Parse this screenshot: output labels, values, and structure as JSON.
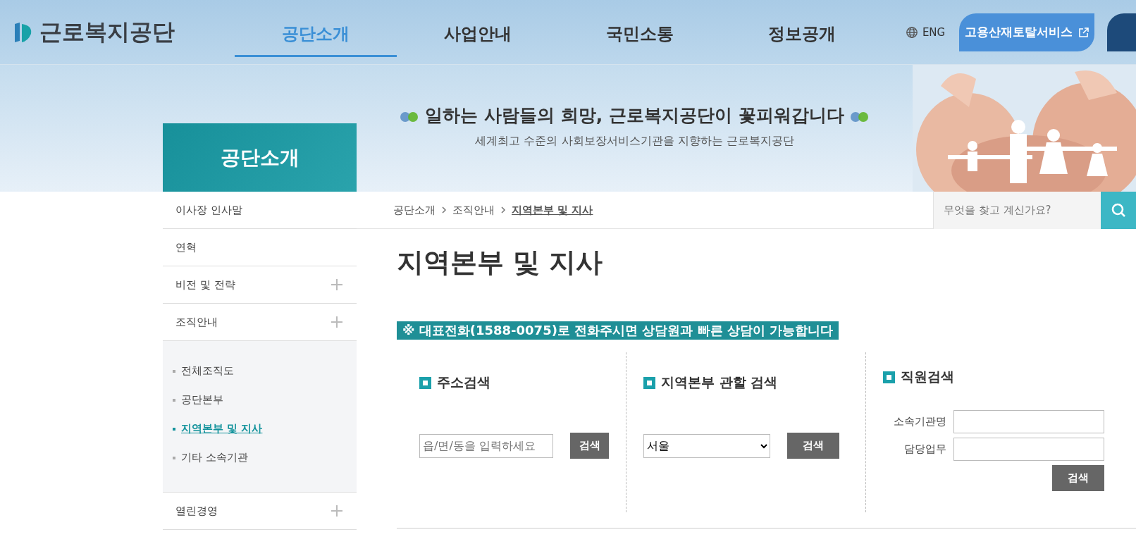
{
  "header": {
    "logo": "근로복지공단",
    "nav": [
      {
        "label": "공단소개",
        "selected": true
      },
      {
        "label": "사업안내",
        "selected": false
      },
      {
        "label": "국민소통",
        "selected": false
      },
      {
        "label": "정보공개",
        "selected": false
      }
    ],
    "language": "ENG",
    "portal_button": "고용산재토탈서비스"
  },
  "banner": {
    "slogan": "일하는 사람들의 희망, 근로복지공단이 꽃피워갑니다",
    "subtitle": "세계최고 수준의 사회보장서비스기관을 지향하는 근로복지공단"
  },
  "sidebar": {
    "title": "공단소개",
    "items": [
      {
        "label": "이사장 인사말",
        "expandable": false
      },
      {
        "label": "연혁",
        "expandable": false
      },
      {
        "label": "비전 및 전략",
        "expandable": true
      },
      {
        "label": "조직안내",
        "expandable": true,
        "children": [
          {
            "label": "전체조직도",
            "selected": false
          },
          {
            "label": "공단본부",
            "selected": false
          },
          {
            "label": "지역본부 및 지사",
            "selected": true
          },
          {
            "label": "기타 소속기관",
            "selected": false
          }
        ]
      },
      {
        "label": "열린경영",
        "expandable": true
      }
    ]
  },
  "breadcrumb": [
    "공단소개",
    "조직안내",
    "지역본부 및 지사"
  ],
  "search": {
    "placeholder": "무엇을 찾고 계신가요?"
  },
  "page_title": "지역본부 및 지사",
  "notice": "※ 대표전화(1588-0075)로 전화주시면 상담원과 빠른 상담이 가능합니다",
  "panels": [
    {
      "kind": "address",
      "title": "주소검색",
      "placeholder": "읍/면/동을 입력하세요",
      "button": "검색"
    },
    {
      "kind": "region",
      "title": "지역본부 관할 검색",
      "value": "서울",
      "button": "검색"
    },
    {
      "kind": "staff",
      "title": "직원검색",
      "fields": [
        "소속기관명",
        "담당업무"
      ],
      "button": "검색"
    }
  ]
}
